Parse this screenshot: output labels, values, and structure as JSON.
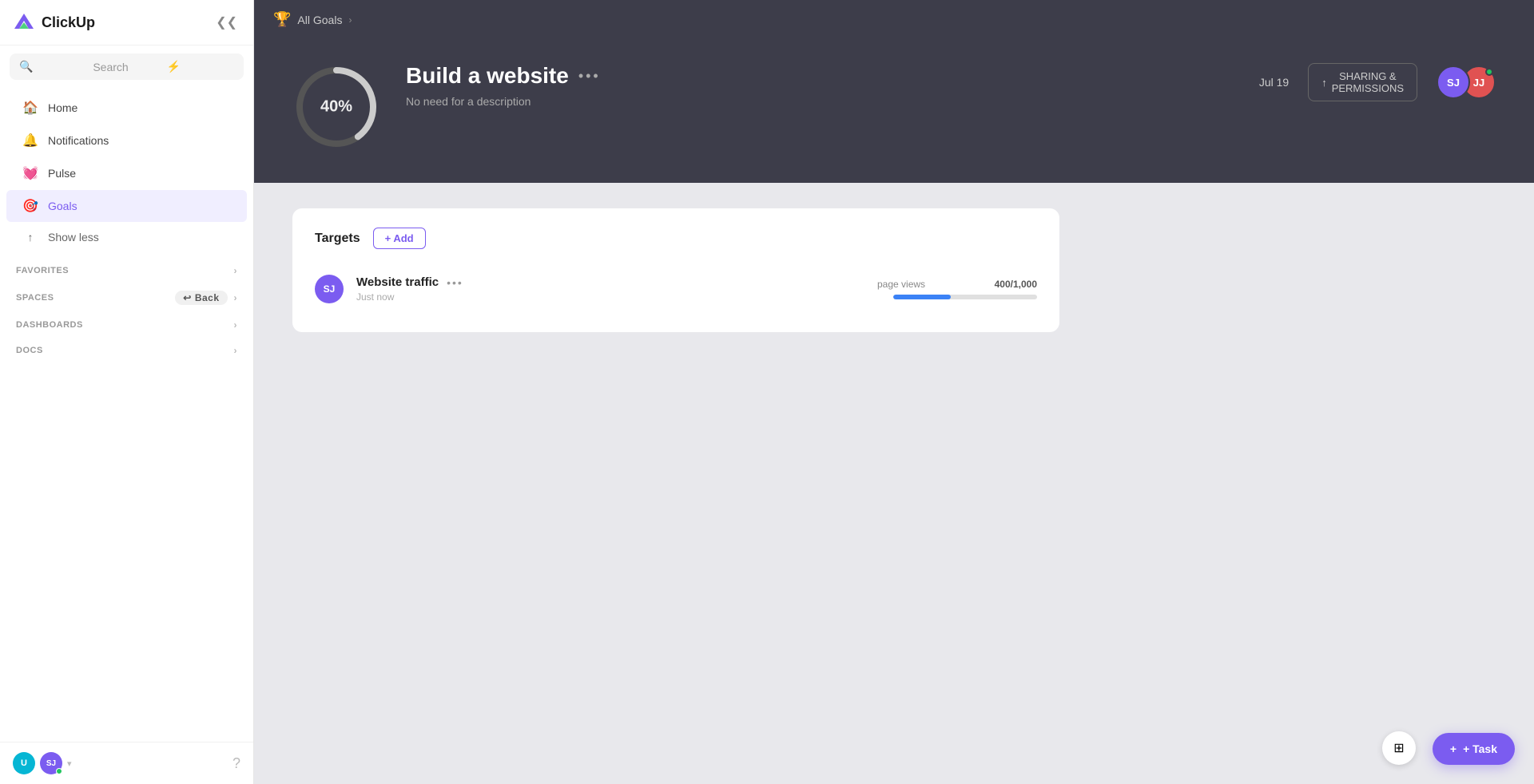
{
  "app": {
    "name": "ClickUp"
  },
  "sidebar": {
    "collapse_label": "Collapse",
    "search_placeholder": "Search",
    "nav_items": [
      {
        "id": "home",
        "label": "Home",
        "icon": "🏠"
      },
      {
        "id": "notifications",
        "label": "Notifications",
        "icon": "🔔"
      },
      {
        "id": "pulse",
        "label": "Pulse",
        "icon": "💓"
      },
      {
        "id": "goals",
        "label": "Goals",
        "icon": "🎯",
        "active": true
      }
    ],
    "show_less_label": "Show less",
    "sections": {
      "favorites": "FAVORITES",
      "spaces": "SPACES",
      "back_label": "Back",
      "dashboards": "DASHBOARDS",
      "docs": "DOCS"
    },
    "user": {
      "initials": "SJ",
      "u_label": "U"
    }
  },
  "breadcrumb": {
    "all_goals_label": "All Goals"
  },
  "goal": {
    "progress_pct": "40%",
    "progress_value": 40,
    "title": "Build a website",
    "description": "No need for a description",
    "date": "Jul 19",
    "sharing_label": "SHARING &\nPERMISSIONS",
    "avatars": [
      {
        "initials": "SJ",
        "color": "#7b5cf0"
      },
      {
        "initials": "JJ",
        "color": "#e05252",
        "online": true
      }
    ]
  },
  "targets": {
    "title": "Targets",
    "add_label": "+ Add",
    "items": [
      {
        "name": "Website traffic",
        "time": "Just now",
        "avatar_initials": "SJ",
        "avatar_color": "#7b5cf0",
        "metric_name": "page views",
        "metric_value": "400/1,000",
        "progress_fill_pct": 40
      }
    ]
  },
  "footer": {
    "add_task_label": "+ Task"
  }
}
